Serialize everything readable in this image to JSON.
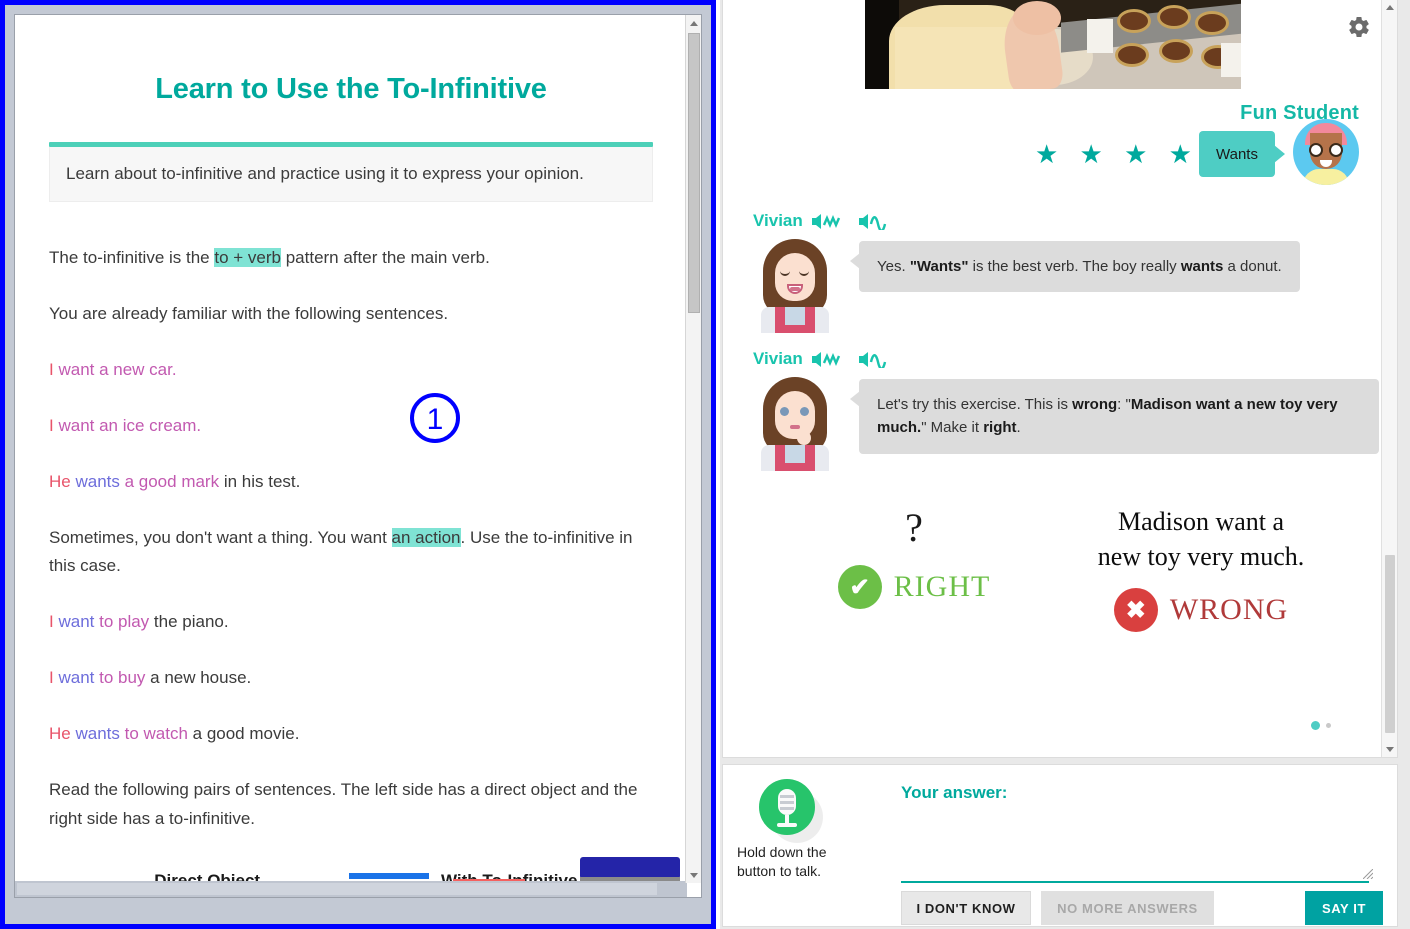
{
  "lesson": {
    "title": "Learn to Use the To-Infinitive",
    "summary": "Learn about to-infinitive and practice using it to express your opinion.",
    "p1_a": "The to-infinitive is the ",
    "p1_hl": "to + verb",
    "p1_b": " pattern after the main verb.",
    "p2": "You are already familiar with the following sentences.",
    "ex1_s1": "I",
    "ex1_s2": " want a new car.",
    "ex2_s1": "I",
    "ex2_s2": " want an ice cream.",
    "ex3_s1": "He",
    "ex3_s2": " wants",
    "ex3_s3": " a good mark",
    "ex3_s4": " in his test.",
    "p3_a": "Sometimes, you don't want a thing. You want ",
    "p3_hl": "an action",
    "p3_b": ". Use the to-infinitive in this case.",
    "ex4_s1": "I",
    "ex4_s2": " want",
    "ex4_s3": " to play",
    "ex4_s4": " the piano.",
    "ex5_s1": "I",
    "ex5_s2": " want",
    "ex5_s3": " to buy",
    "ex5_s4": " a new house.",
    "ex6_s1": "He",
    "ex6_s2": " wants",
    "ex6_s3": " to watch",
    "ex6_s4": " a good movie.",
    "p4": "Read the following pairs of sentences. The left side has a direct object and the right side has a to-infinitive.",
    "col_direct_object": "Direct Object",
    "col_with_to_infinitive": "With To-Infinitive",
    "annotation_marker": "1"
  },
  "student": {
    "name": "Fun Student",
    "stars": "★ ★ ★ ★ ★",
    "star_count": 5,
    "bubble_word": "Wants"
  },
  "chat": [
    {
      "speaker": "Vivian",
      "text_parts": [
        {
          "t": "Yes. ",
          "b": false
        },
        {
          "t": "\"Wants\"",
          "b": true
        },
        {
          "t": " is the best verb. The boy really ",
          "b": false
        },
        {
          "t": "wants",
          "b": true
        },
        {
          "t": " a donut.",
          "b": false
        }
      ]
    },
    {
      "speaker": "Vivian",
      "text_parts": [
        {
          "t": "Let's try this exercise. This is ",
          "b": false
        },
        {
          "t": "wrong",
          "b": true
        },
        {
          "t": ": \"",
          "b": false
        },
        {
          "t": "Madison want a new toy very much.",
          "b": true
        },
        {
          "t": "\" Make it ",
          "b": false
        },
        {
          "t": "right",
          "b": true
        },
        {
          "t": ".",
          "b": false
        }
      ]
    }
  ],
  "exercise": {
    "left_symbol": "?",
    "left_label": "RIGHT",
    "right_sentence_line1": "Madison want a",
    "right_sentence_line2": "new toy very much.",
    "right_label": "WRONG"
  },
  "answer": {
    "mic_hint_line1": "Hold down the",
    "mic_hint_line2": "button to talk.",
    "label": "Your answer:",
    "value": "",
    "placeholder": "",
    "btn_dont_know": "I DON'T KNOW",
    "btn_no_more": "NO MORE ANSWERS",
    "btn_say_it": "SAY IT"
  },
  "colors": {
    "teal": "#00a99d",
    "teal_light": "#4ecdc4",
    "highlight": "#7fe3d4",
    "annotation_blue": "#0000ff",
    "right_green": "#6cbf47",
    "wrong_red": "#b03a3a",
    "mic_green": "#27c46b"
  }
}
